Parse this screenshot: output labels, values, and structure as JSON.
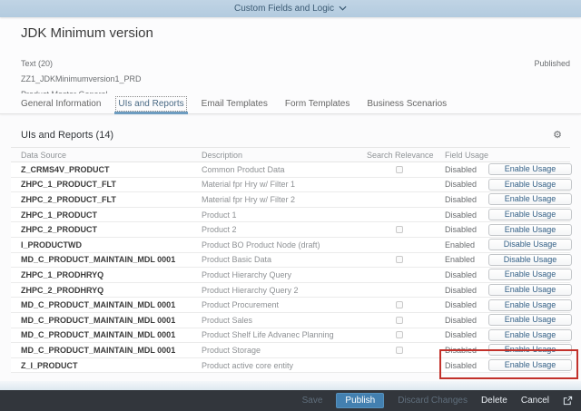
{
  "shell": {
    "app_switcher_label": "Custom Fields and Logic"
  },
  "object_header": {
    "title": "JDK Minimum version",
    "field_type": "Text (20)",
    "status": "Published",
    "technical_name": "ZZ1_JDKMinimumversion1_PRD",
    "business_context": "Product Master General"
  },
  "tabs": [
    {
      "label": "General Information",
      "selected": false
    },
    {
      "label": "UIs and Reports",
      "selected": true
    },
    {
      "label": "Email Templates",
      "selected": false
    },
    {
      "label": "Form Templates",
      "selected": false
    },
    {
      "label": "Business Scenarios",
      "selected": false
    }
  ],
  "section": {
    "title": "UIs and Reports (14)"
  },
  "icons": {
    "settings_glyph": "⚙",
    "chevron_down": "chevron-down",
    "open_in_new": "open-in-new-window"
  },
  "table": {
    "columns": [
      "Data Source",
      "Description",
      "Search Relevance",
      "Field Usage"
    ],
    "rows": [
      {
        "data_source": "Z_CRMS4V_PRODUCT",
        "description": "Common Product Data",
        "has_checkbox": true,
        "status": "Disabled",
        "action": "Enable Usage",
        "highlighted": false
      },
      {
        "data_source": "ZHPC_1_PRODUCT_FLT",
        "description": "Material fpr Hry w/ Filter 1",
        "has_checkbox": false,
        "status": "Disabled",
        "action": "Enable Usage",
        "highlighted": false
      },
      {
        "data_source": "ZHPC_2_PRODUCT_FLT",
        "description": "Material fpr Hry w/ Filter 2",
        "has_checkbox": false,
        "status": "Disabled",
        "action": "Enable Usage",
        "highlighted": false
      },
      {
        "data_source": "ZHPC_1_PRODUCT",
        "description": "Product 1",
        "has_checkbox": false,
        "status": "Disabled",
        "action": "Enable Usage",
        "highlighted": false
      },
      {
        "data_source": "ZHPC_2_PRODUCT",
        "description": "Product 2",
        "has_checkbox": true,
        "status": "Disabled",
        "action": "Enable Usage",
        "highlighted": false
      },
      {
        "data_source": "I_PRODUCTWD",
        "description": "Product BO Product Node (draft)",
        "has_checkbox": false,
        "status": "Enabled",
        "action": "Disable Usage",
        "highlighted": true
      },
      {
        "data_source": "MD_C_PRODUCT_MAINTAIN_MDL 0001",
        "description": "Product Basic Data",
        "has_checkbox": true,
        "status": "Enabled",
        "action": "Disable Usage",
        "highlighted": true
      },
      {
        "data_source": "ZHPC_1_PRODHRYQ",
        "description": "Product Hierarchy Query",
        "has_checkbox": false,
        "status": "Disabled",
        "action": "Enable Usage",
        "highlighted": false
      },
      {
        "data_source": "ZHPC_2_PRODHRYQ",
        "description": "Product Hierarchy Query 2",
        "has_checkbox": false,
        "status": "Disabled",
        "action": "Enable Usage",
        "highlighted": false
      },
      {
        "data_source": "MD_C_PRODUCT_MAINTAIN_MDL 0001",
        "description": "Product Procurement",
        "has_checkbox": true,
        "status": "Disabled",
        "action": "Enable Usage",
        "highlighted": false
      },
      {
        "data_source": "MD_C_PRODUCT_MAINTAIN_MDL 0001",
        "description": "Product Sales",
        "has_checkbox": true,
        "status": "Disabled",
        "action": "Enable Usage",
        "highlighted": false
      },
      {
        "data_source": "MD_C_PRODUCT_MAINTAIN_MDL 0001",
        "description": "Product Shelf Life Advanec Planning",
        "has_checkbox": true,
        "status": "Disabled",
        "action": "Enable Usage",
        "highlighted": false
      },
      {
        "data_source": "MD_C_PRODUCT_MAINTAIN_MDL 0001",
        "description": "Product Storage",
        "has_checkbox": true,
        "status": "Disabled",
        "action": "Enable Usage",
        "highlighted": false
      },
      {
        "data_source": "Z_I_PRODUCT",
        "description": "Product active core entity",
        "has_checkbox": false,
        "status": "Disabled",
        "action": "Enable Usage",
        "highlighted": false
      }
    ]
  },
  "footer": {
    "actions": [
      {
        "label": "Save",
        "enabled": false,
        "primary": false
      },
      {
        "label": "Publish",
        "enabled": true,
        "primary": true
      },
      {
        "label": "Discard Changes",
        "enabled": false,
        "primary": false
      },
      {
        "label": "Delete",
        "enabled": true,
        "primary": false
      },
      {
        "label": "Cancel",
        "enabled": true,
        "primary": false
      }
    ]
  },
  "colors": {
    "shell_bg": "#b9cfe2",
    "accent_blue": "#4380b0",
    "tab_underline": "#6d9cc0",
    "annotation_red": "#c2312b",
    "footer_bg": "#32363c"
  }
}
